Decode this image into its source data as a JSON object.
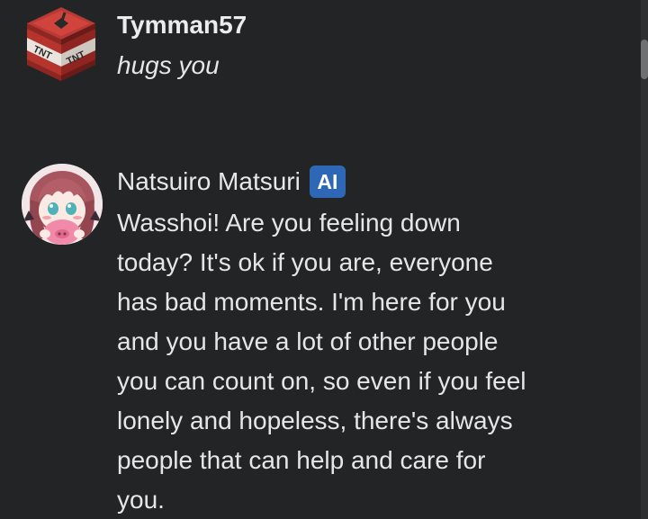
{
  "messages": [
    {
      "author": "Tymman57",
      "avatar_icon": "tnt-block-icon",
      "avatar_text": "TNT",
      "text": "hugs you"
    },
    {
      "author": "Natsuiro Matsuri",
      "badge": "AI",
      "avatar_icon": "anime-girl-avatar-icon",
      "text_lines": [
        "Wasshoi! Are you feeling down",
        "today? It's ok if you are, everyone",
        "has bad moments. I'm here for you",
        "and you have a lot of other people",
        "you can count on, so even if you feel",
        "lonely and hopeless, there's always",
        "people that can help and care for",
        "you."
      ]
    }
  ],
  "colors": {
    "background": "#232425",
    "text": "#e6e6e6",
    "badge": "#2f67b7",
    "tnt_red": "#c7302a"
  }
}
